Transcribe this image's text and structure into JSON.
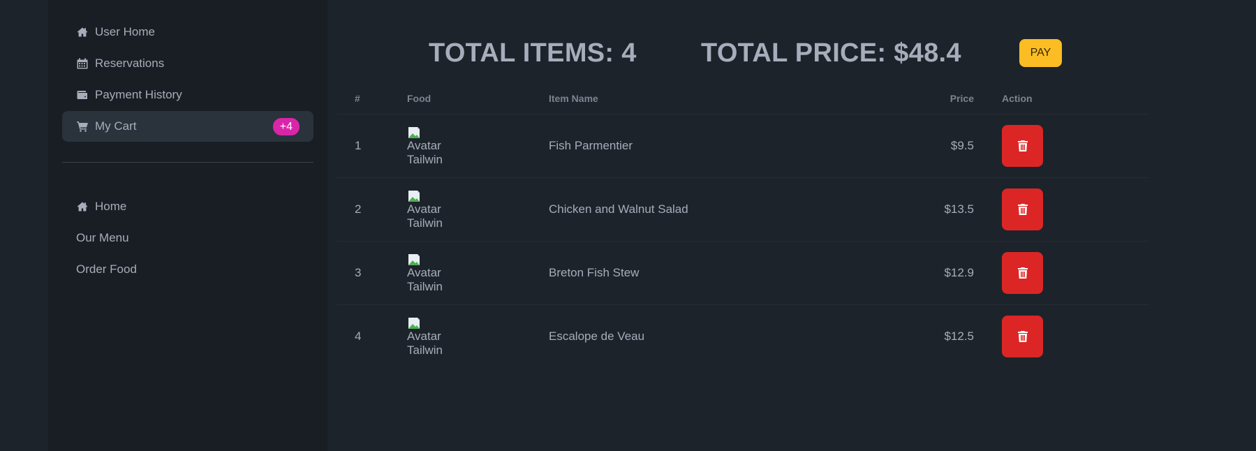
{
  "sidebar": {
    "user_nav": [
      {
        "label": "User Home",
        "icon": "home-icon"
      },
      {
        "label": "Reservations",
        "icon": "calendar-icon"
      },
      {
        "label": "Payment History",
        "icon": "wallet-icon"
      },
      {
        "label": "My Cart",
        "icon": "cart-icon",
        "badge": "+4",
        "active": true
      }
    ],
    "main_nav": [
      {
        "label": "Home",
        "icon": "home-icon"
      },
      {
        "label": "Our Menu"
      },
      {
        "label": "Order Food"
      }
    ]
  },
  "summary": {
    "total_items": "TOTAL ITEMS: 4",
    "total_price": "TOTAL PRICE: $48.4",
    "pay_label": "PAY"
  },
  "table": {
    "headers": {
      "num": "#",
      "food": "Food",
      "name": "Item Name",
      "price": "Price",
      "action": "Action"
    },
    "rows": [
      {
        "num": "1",
        "avatar_alt": "Avatar Tailwind",
        "name": "Fish Parmentier",
        "price": "$9.5"
      },
      {
        "num": "2",
        "avatar_alt": "Avatar Tailwind",
        "name": "Chicken and Walnut Salad",
        "price": "$13.5"
      },
      {
        "num": "3",
        "avatar_alt": "Avatar Tailwind",
        "name": "Breton Fish Stew",
        "price": "$12.9"
      },
      {
        "num": "4",
        "avatar_alt": "Avatar Tailwind",
        "name": "Escalope de Veau",
        "price": "$12.5"
      }
    ]
  },
  "colors": {
    "page_bg": "#1d232a",
    "sidebar_bg": "#191e24",
    "badge": "#d926a9",
    "pay": "#fbbd23",
    "delete": "#dc2626"
  }
}
